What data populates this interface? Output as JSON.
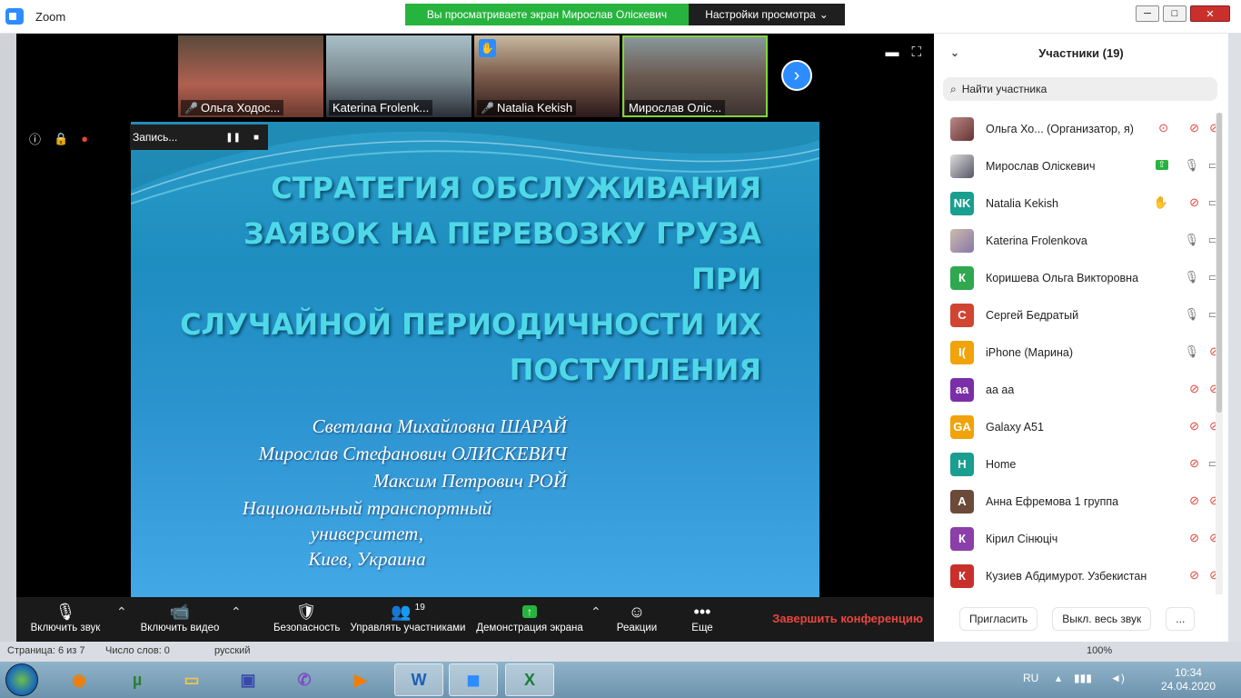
{
  "window": {
    "app_title": "Zoom",
    "viewing_banner": "Вы просматриваете экран Мирослав Оліскевич",
    "view_settings": "Настройки просмотра",
    "min": "─",
    "max": "□",
    "close": "✕"
  },
  "thumbnails": [
    {
      "name": "Ольга Ходос...",
      "muted": true
    },
    {
      "name": "Katerina Frolenk...",
      "muted": false
    },
    {
      "name": "Natalia Kekish",
      "muted": true,
      "hand": true
    },
    {
      "name": "Мирослав Оліс...",
      "muted": false,
      "active": true
    }
  ],
  "recording": {
    "label": "Запись...",
    "pause": "❚❚",
    "stop": "■"
  },
  "slide": {
    "title_lines": [
      "СТРАТЕГИЯ ОБСЛУЖИВАНИЯ",
      "ЗАЯВОК НА ПЕРЕВОЗКУ ГРУЗА ПРИ",
      "СЛУЧАЙНОЙ ПЕРИОДИЧНОСТИ ИХ",
      "ПОСТУПЛЕНИЯ"
    ],
    "authors": [
      "Светлана  Михайловна ШАРАЙ",
      "Мирослав Стефанович ОЛИСКЕВИЧ",
      "Максим  Петрович РОЙ"
    ],
    "institution": [
      "Национальный транспортный",
      "университет,",
      "Киев, Украина"
    ]
  },
  "toolbar": {
    "audio": "Включить звук",
    "video": "Включить видео",
    "security": "Безопасность",
    "participants": "Управлять участниками",
    "participants_count": "19",
    "share": "Демонстрация экрана",
    "reactions": "Реакции",
    "more": "Еще",
    "end": "Завершить конференцию"
  },
  "panel": {
    "title": "Участники (19)",
    "search_placeholder": "Найти участника",
    "invite": "Пригласить",
    "mute_all": "Выкл. весь звук",
    "more": "...",
    "participants": [
      {
        "initials": "",
        "name": "Ольга Хо...  (Организатор, я)",
        "color": "photo",
        "mic": "off",
        "cam": "off",
        "extra": "rec"
      },
      {
        "initials": "",
        "name": "Мирослав Оліскевич",
        "color": "photo2",
        "mic": "on",
        "cam": "on",
        "extra": "share"
      },
      {
        "initials": "NK",
        "name": "Natalia Kekish",
        "color": "#1a9e8f",
        "mic": "off",
        "cam": "on",
        "extra": "hand"
      },
      {
        "initials": "",
        "name": "Katerina Frolenkova",
        "color": "photo3",
        "mic": "on",
        "cam": "on",
        "extra": ""
      },
      {
        "initials": "К",
        "name": "Коришева Ольга Викторовна",
        "color": "#2fa84f",
        "mic": "on",
        "cam": "on",
        "extra": ""
      },
      {
        "initials": "С",
        "name": "Сергей Бедратый",
        "color": "#d04532",
        "mic": "on",
        "cam": "on",
        "extra": ""
      },
      {
        "initials": "I(",
        "name": "iPhone (Марина)",
        "color": "#f0a30a",
        "mic": "on",
        "cam": "off",
        "extra": ""
      },
      {
        "initials": "aa",
        "name": "aa aa",
        "color": "#7a2fa8",
        "mic": "off",
        "cam": "off",
        "extra": ""
      },
      {
        "initials": "GA",
        "name": "Galaxy A51",
        "color": "#f0a30a",
        "mic": "off",
        "cam": "off",
        "extra": ""
      },
      {
        "initials": "H",
        "name": "Home",
        "color": "#1a9e8f",
        "mic": "off",
        "cam": "on",
        "extra": ""
      },
      {
        "initials": "А",
        "name": "Анна Ефремова 1 группа",
        "color": "#6b4a3a",
        "mic": "off",
        "cam": "off",
        "extra": ""
      },
      {
        "initials": "К",
        "name": "Кірил Сінюціч",
        "color": "#8b3fa8",
        "mic": "off",
        "cam": "off",
        "extra": ""
      },
      {
        "initials": "К",
        "name": "Кузиев Абдимурот. Узбекистан",
        "color": "#c9302c",
        "mic": "off",
        "cam": "off",
        "extra": ""
      }
    ]
  },
  "word_status": {
    "page": "Страница: 6 из 7",
    "words": "Число слов: 0",
    "lang": "русский",
    "zoom": "100%"
  },
  "taskbar": {
    "lang": "RU",
    "time": "10:34",
    "date": "24.04.2020"
  }
}
